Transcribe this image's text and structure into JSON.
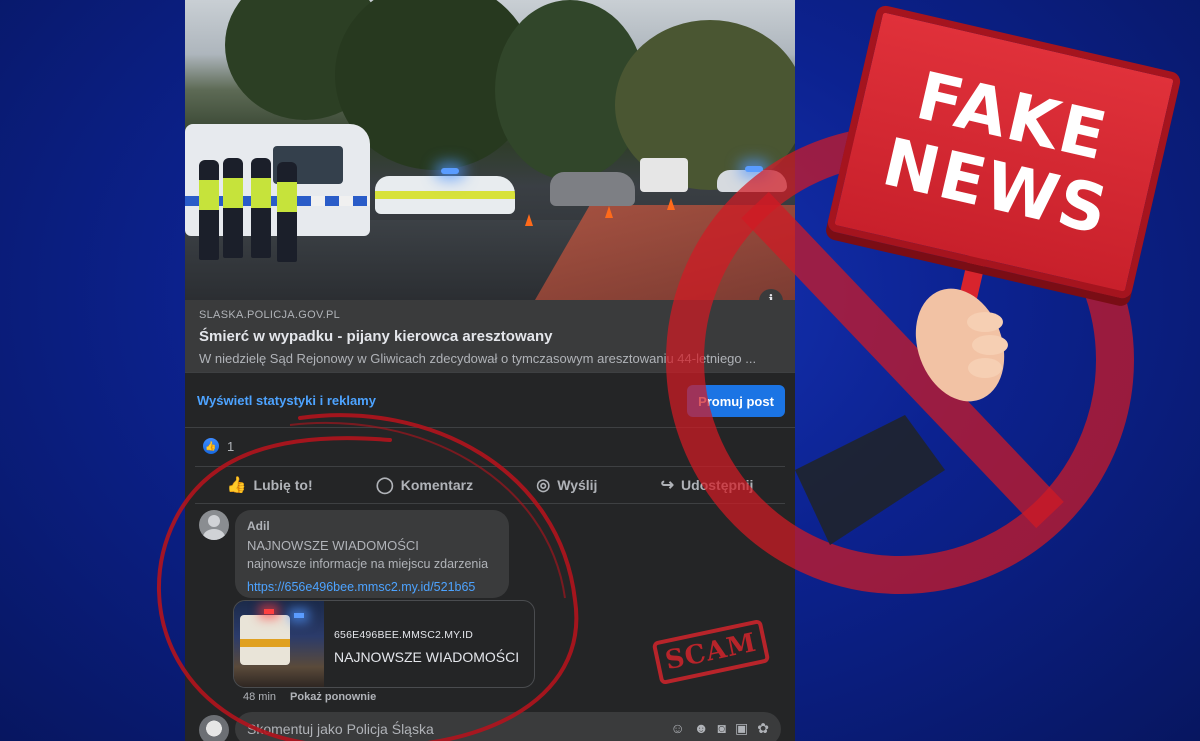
{
  "post": {
    "link_preview": {
      "domain": "SLASKA.POLICJA.GOV.PL",
      "title": "Śmierć w wypadku - pijany kierowca aresztowany",
      "description": "W niedzielę Sąd Rejonowy w Gliwicach zdecydował o tymczasowym aresztowaniu 44-letniego ..."
    },
    "info_icon": "info-icon",
    "stats_link": "Wyświetl statystyki i reklamy",
    "promote_button": "Promuj post",
    "reaction_count": "1",
    "actions": {
      "like": "Lubię to!",
      "comment": "Komentarz",
      "send": "Wyślij",
      "share": "Udostępnij"
    }
  },
  "comment": {
    "author": "Adil",
    "line1": "NAJNOWSZE WIADOMOŚCI",
    "line2": "najnowsze informacje na miejscu zdarzenia",
    "link": "https://656e496bee.mmsc2.my.id/521b65",
    "attachment": {
      "domain": "656E496BEE.MMSC2.MY.ID",
      "title": "NAJNOWSZE WIADOMOŚCI"
    },
    "time": "48 min",
    "show_again": "Pokaż ponownie"
  },
  "composer": {
    "placeholder": "Skomentuj jako Policja Śląska"
  },
  "overlay": {
    "sign_line1": "FAKE",
    "sign_line2": "NEWS",
    "stamp": "SCAM"
  },
  "colors": {
    "background": "#0c2290",
    "panel": "#242526",
    "accent_blue": "#1b74e4",
    "warning_red": "#c0242b"
  }
}
